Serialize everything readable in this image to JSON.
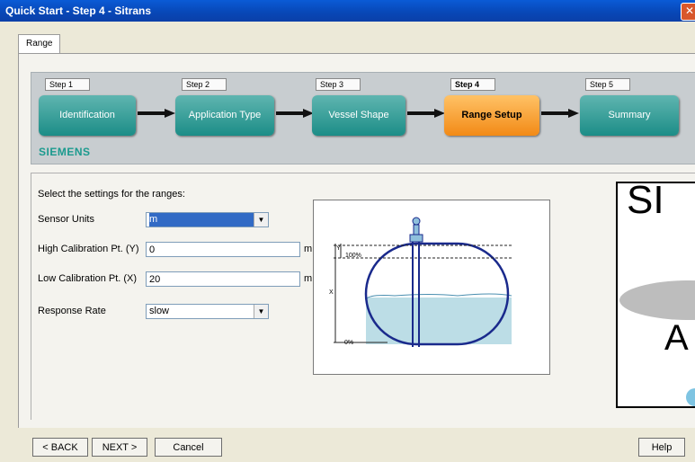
{
  "window": {
    "title": "Quick Start - Step 4 - Sitrans",
    "close_glyph": "✕"
  },
  "tabs": [
    {
      "label": "Range Setup"
    }
  ],
  "steps": [
    {
      "tag": "Step 1",
      "label": "Identification",
      "active": false
    },
    {
      "tag": "Step 2",
      "label": "Application Type",
      "active": false
    },
    {
      "tag": "Step 3",
      "label": "Vessel Shape",
      "active": false
    },
    {
      "tag": "Step 4",
      "label": "Range Setup",
      "active": true
    },
    {
      "tag": "Step 5",
      "label": "Summary",
      "active": false
    }
  ],
  "brand": "SIEMENS",
  "form": {
    "intro": "Select the settings for the ranges:",
    "sensor_units": {
      "label": "Sensor Units",
      "value": "m"
    },
    "high_cal": {
      "label": "High Calibration Pt. (Y)",
      "value": "0",
      "unit": "m"
    },
    "low_cal": {
      "label": "Low Calibration Pt. (X)",
      "value": "20",
      "unit": "m"
    },
    "response_rate": {
      "label": "Response Rate",
      "value": "slow"
    }
  },
  "diagram": {
    "label_100": "100%",
    "label_0": "0%",
    "label_x": "X",
    "label_y": "Y"
  },
  "overlay": {
    "text": "SI",
    "letter": "A"
  },
  "buttons": {
    "back": "< BACK",
    "next": "NEXT >",
    "cancel": "Cancel",
    "help": "Help"
  },
  "colors": {
    "title_bar": "#0a5bd6",
    "step_teal": "#1c8d87",
    "step_active": "#f28a16",
    "brand": "#1b9a8e"
  }
}
